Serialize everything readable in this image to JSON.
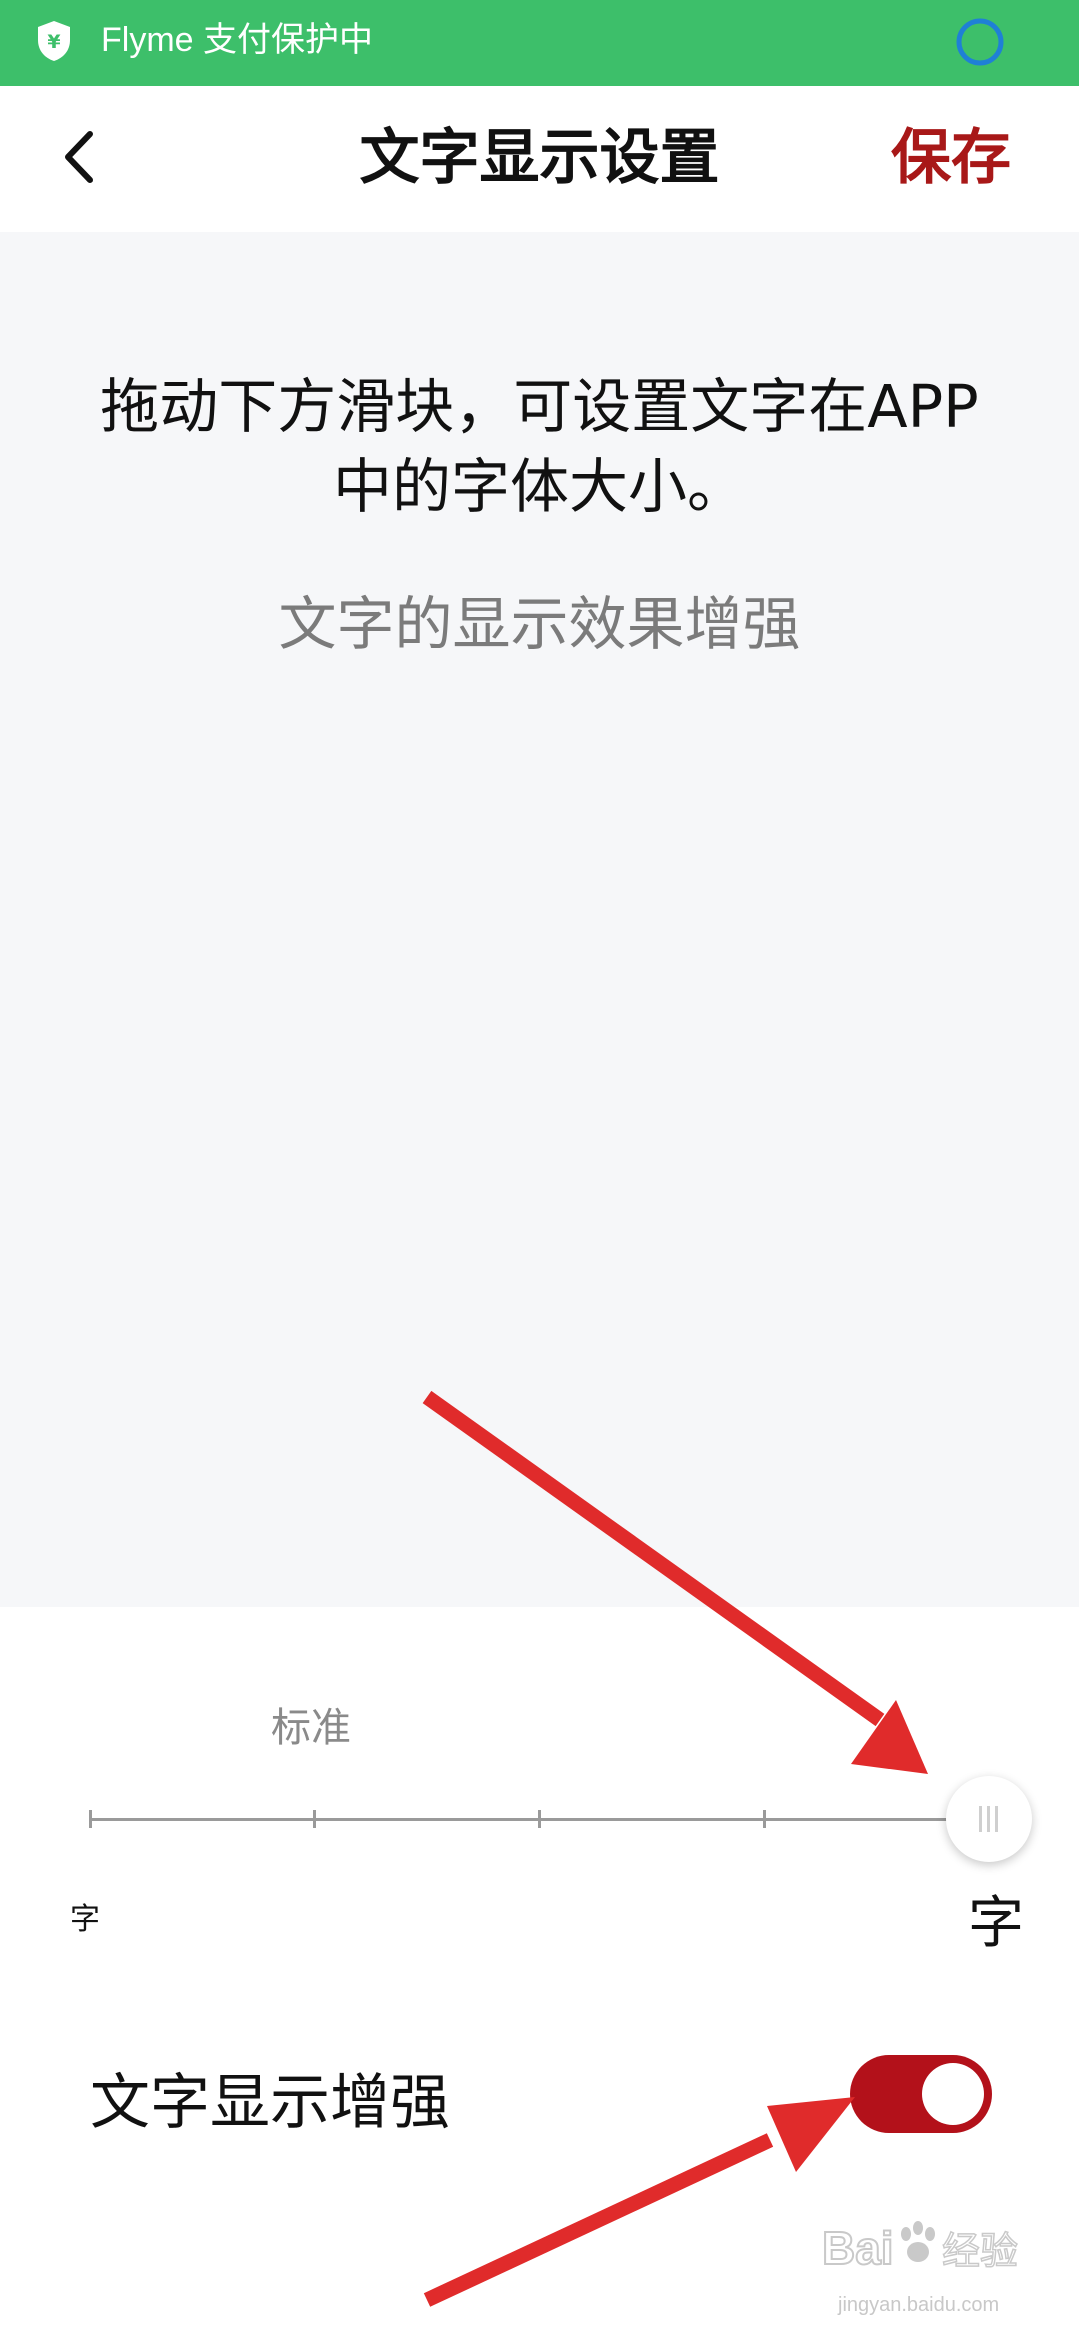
{
  "status_bar": {
    "text": "Flyme 支付保护中",
    "background": "#3dbf6a",
    "shield_icon": "shield-yen-icon",
    "ring_icon": "progress-ring-icon"
  },
  "nav": {
    "back_icon": "chevron-left-icon",
    "title": "文字显示设置",
    "save_label": "保存",
    "save_color": "#a81818"
  },
  "preview": {
    "main_text": "拖动下方滑块，可设置文字在APP中的字体大小。",
    "sub_text": "文字的显示效果增强"
  },
  "font_slider": {
    "standard_label": "标准",
    "small_label": "字",
    "large_label": "字",
    "steps": 5,
    "standard_step": 2,
    "selected_step": 5
  },
  "enhance": {
    "label": "文字显示增强",
    "enabled": true,
    "toggle_color": "#b3111a"
  },
  "annotation_color": "#e02b2b",
  "watermark": {
    "logo": "Bai度经验",
    "caption": "jingyan.baidu.com"
  }
}
